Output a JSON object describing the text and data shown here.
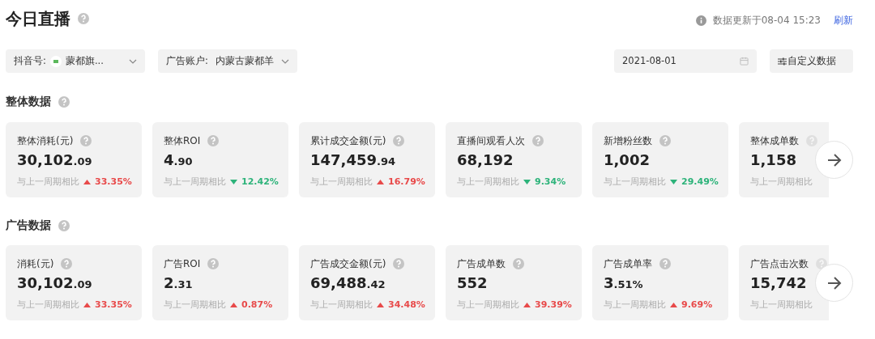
{
  "header": {
    "title": "今日直播",
    "update_text": "数据更新于08-04 15:23",
    "refresh_link": "刷新"
  },
  "filters": {
    "douyin": {
      "label": "抖音号:",
      "value": "蒙都旗..."
    },
    "ad_account": {
      "label": "广告账户:",
      "value": "内蒙古蒙都羊"
    },
    "date": {
      "value": "2021-08-01"
    },
    "custom_button": "自定义数据"
  },
  "sections": [
    {
      "title": "整体数据",
      "cards": [
        {
          "label": "整体消耗(元)",
          "value": "30,102",
          "fraction": ".09",
          "compare": "与上一周期相比",
          "rising": true,
          "change": "33.35%"
        },
        {
          "label": "整体ROI",
          "value": "4",
          "fraction": ".90",
          "compare": "与上一周期相比",
          "rising": false,
          "change": "12.42%"
        },
        {
          "label": "累计成交金额(元)",
          "value": "147,459",
          "fraction": ".94",
          "compare": "与上一周期相比",
          "rising": true,
          "change": "16.79%"
        },
        {
          "label": "直播间观看人次",
          "value": "68,192",
          "compare": "与上一周期相比",
          "rising": false,
          "change": "9.34%"
        },
        {
          "label": "新增粉丝数",
          "value": "1,002",
          "compare": "与上一周期相比",
          "rising": false,
          "change": "29.49%"
        },
        {
          "label": "整体成单数",
          "value": "1,158",
          "compare": "与上一周期相比"
        }
      ]
    },
    {
      "title": "广告数据",
      "cards": [
        {
          "label": "消耗(元)",
          "value": "30,102",
          "fraction": ".09",
          "compare": "与上一周期相比",
          "rising": true,
          "change": "33.35%"
        },
        {
          "label": "广告ROI",
          "value": "2",
          "fraction": ".31",
          "compare": "与上一周期相比",
          "rising": true,
          "change": "0.87%"
        },
        {
          "label": "广告成交金额(元)",
          "value": "69,488",
          "fraction": ".42",
          "compare": "与上一周期相比",
          "rising": true,
          "change": "34.48%"
        },
        {
          "label": "广告成单数",
          "value": "552",
          "compare": "与上一周期相比",
          "rising": true,
          "change": "39.39%"
        },
        {
          "label": "广告成单率",
          "value": "3",
          "fraction": ".51%",
          "compare": "与上一周期相比",
          "rising": true,
          "change": "9.69%"
        },
        {
          "label": "广告点击次数",
          "value": "15,742",
          "compare": "与上一周期相比"
        }
      ]
    }
  ]
}
